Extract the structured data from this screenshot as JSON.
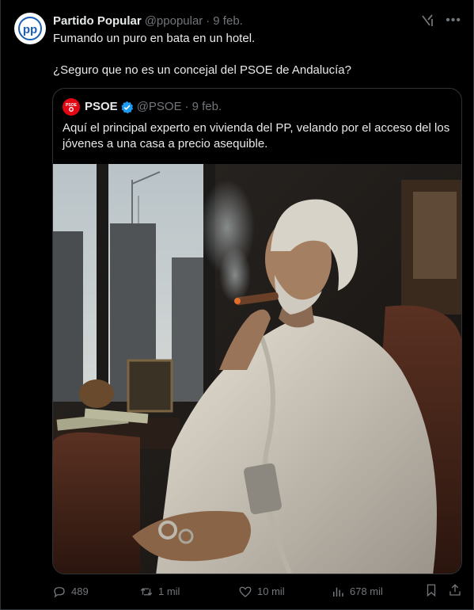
{
  "post": {
    "author_name": "Partido Popular",
    "author_handle": "@ppopular",
    "separator": "·",
    "date": "9 feb.",
    "avatar_icon": "pp-logo-icon",
    "more_icon": "more-icon",
    "grok_icon": "grok-icon",
    "text_line_1": "Fumando un puro en bata en un hotel.",
    "text_line_2": "¿Seguro que no es un concejal del PSOE de Andalucía?"
  },
  "quoted": {
    "author_name": "PSOE",
    "author_handle": "@PSOE",
    "separator": "·",
    "date": "9 feb.",
    "verified": true,
    "avatar_icon": "psoe-rose-logo-icon",
    "text": "Aquí el principal experto en vivienda del PP, velando por el acceso del los jóvenes a una casa a precio asequible.",
    "image_description_icon": "photo-image"
  },
  "actions": {
    "replies": "489",
    "reposts": "1 mil",
    "likes": "10 mil",
    "views": "678 mil"
  },
  "colors": {
    "background": "#000000",
    "text_primary": "#e7e9ea",
    "text_secondary": "#71767b",
    "border": "#2f3336",
    "verified_blue": "#1d9bf0",
    "psoe_red": "#e30613",
    "pp_blue": "#1a5fb4"
  }
}
